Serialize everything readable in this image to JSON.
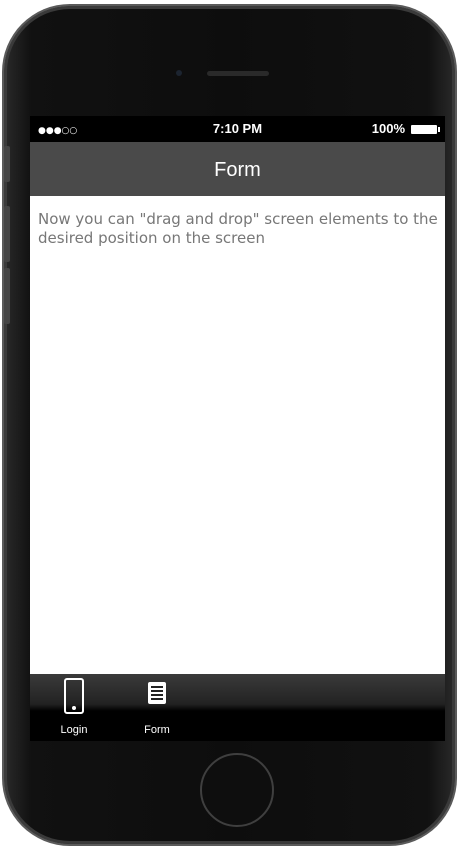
{
  "status_bar": {
    "signal": "●●●○○",
    "time": "7:10 PM",
    "battery": "100%"
  },
  "nav": {
    "title": "Form"
  },
  "content": {
    "message": "Now you can \"drag and drop\" screen elements to the desired position on the screen"
  },
  "tabs": [
    {
      "label": "Login",
      "icon": "phone-icon"
    },
    {
      "label": "Form",
      "icon": "form-list-icon"
    }
  ],
  "colors": {
    "nav_bar": "#4a4a4a",
    "status_bar": "#000000",
    "body_text": "#777777",
    "phone_body": "#111111"
  }
}
